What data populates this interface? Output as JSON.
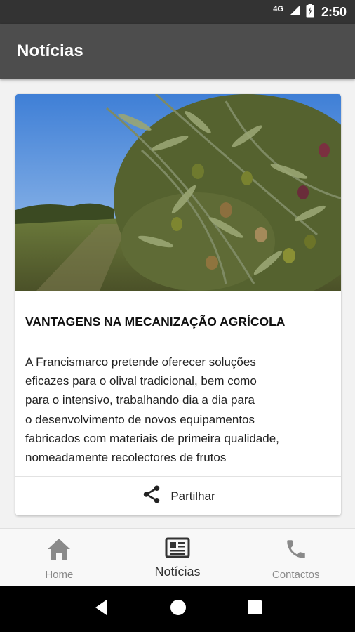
{
  "status_bar": {
    "network": "4G",
    "time": "2:50"
  },
  "app_bar": {
    "title": "Notícias"
  },
  "article": {
    "title": "VANTAGENS NA MECANIZAÇÃO AGRÍCOLA",
    "body_lines": [
      "A Francismarco pretende oferecer soluções",
      "eficazes para o olival tradicional, bem como",
      "para o intensivo, trabalhando dia a dia para",
      "o desenvolvimento de novos equipamentos",
      "fabricados com materiais de primeira qualidade,",
      "nomeadamente recolectores de frutos"
    ],
    "share_label": "Partilhar",
    "share_icon": "share-icon"
  },
  "bottom_nav": {
    "items": [
      {
        "label": "Home",
        "icon": "home-icon",
        "active": false
      },
      {
        "label": "Notícias",
        "icon": "newspaper-icon",
        "active": true
      },
      {
        "label": "Contactos",
        "icon": "phone-icon",
        "active": false
      }
    ]
  },
  "colors": {
    "status_bar": "#333333",
    "app_bar": "#4d4d4d",
    "background": "#f2f2f2",
    "active_nav": "#333333",
    "inactive_nav": "#8a8a8a"
  }
}
